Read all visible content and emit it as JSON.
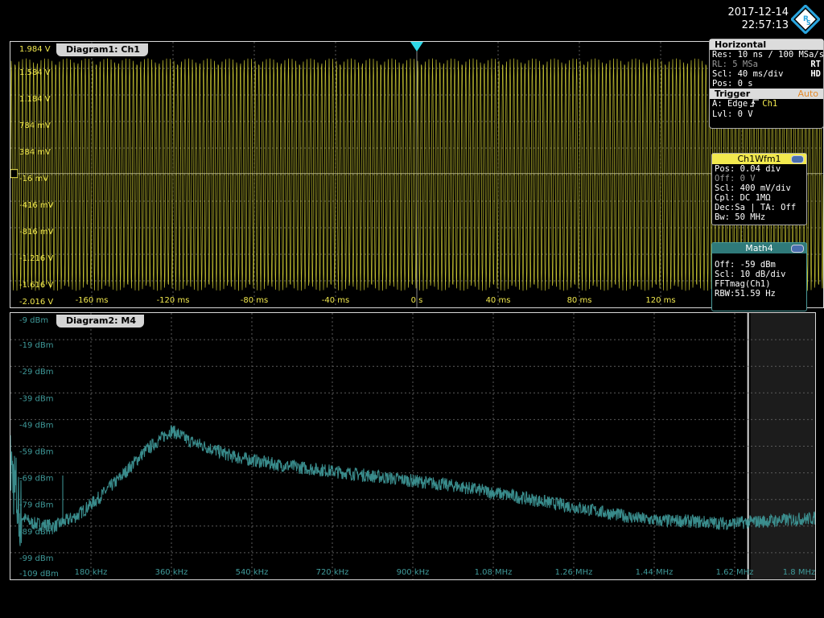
{
  "header": {
    "date": "2017-12-14",
    "time": "22:57:13",
    "logo_letters": "RS"
  },
  "diagram1": {
    "title": "Diagram1: Ch1",
    "y_labels": [
      "1.984 V",
      "1.584 V",
      "1.184 V",
      "784 mV",
      "384 mV",
      "-16 mV",
      "-416 mV",
      "-816 mV",
      "-1.216 V",
      "-1.616 V",
      "-2.016 V"
    ],
    "x_labels": [
      "-160 ms",
      "-120 ms",
      "-80 ms",
      "-40 ms",
      "0 s",
      "40 ms",
      "80 ms",
      "120 ms"
    ],
    "trace_color": "#e8e43a"
  },
  "diagram2": {
    "title": "Diagram2: M4",
    "y_labels": [
      "-9 dBm",
      "-19 dBm",
      "-29 dBm",
      "-39 dBm",
      "-49 dBm",
      "-59 dBm",
      "-69 dBm",
      "-79 dBm",
      "-89 dBm",
      "-99 dBm",
      "-109 dBm"
    ],
    "x_labels": [
      "180 kHz",
      "360 kHz",
      "540 kHz",
      "720 kHz",
      "900 kHz",
      "1.08 MHz",
      "1.26 MHz",
      "1.44 MHz",
      "1.62 MHz",
      "1.8 MHz"
    ],
    "trace_color": "#3f9a9a"
  },
  "horizontal_panel": {
    "title": "Horizontal",
    "res": "Res: 10 ns / 100 MSa/s",
    "rl": "RL:  5 MSa",
    "rt": "RT",
    "scl": "Scl:  40 ms/div",
    "hd": "HD",
    "pos": "Pos: 0 s",
    "trigger_title": "Trigger",
    "trigger_mode": "Auto",
    "trigger_a_prefix": "A:   Edge",
    "trigger_source": "Ch1",
    "trigger_lvl": "Lvl:  0 V"
  },
  "ch1_box": {
    "title": "Ch1Wfm1",
    "pos": "Pos: 0.04 div",
    "off": "Off:  0 V",
    "scl": "Scl:  400 mV/div",
    "cpl": "Cpl:  DC 1MΩ",
    "dec": "Dec:Sa | TA: Off",
    "bw": "Bw:  50 MHz"
  },
  "math4_box": {
    "title": "Math4",
    "off": "Off:   -59 dBm",
    "scl": "Scl:  10 dB/div",
    "fft": "FFTmag(Ch1)",
    "rbw": "RBW:51.59 Hz"
  },
  "chart_data": [
    {
      "type": "line",
      "title": "Diagram1: Ch1",
      "xlabel": "",
      "ylabel": "",
      "x_unit": "ms",
      "xlim": [
        -200,
        200
      ],
      "ylim": [
        -2.016,
        1.984
      ],
      "series": [
        {
          "description": "dense sinusoid",
          "amplitude_V": 1.75,
          "offset_V": -0.016
        }
      ]
    },
    {
      "type": "line",
      "title": "Diagram2: M4",
      "xlabel": "",
      "ylabel": "",
      "x_unit": "kHz",
      "xlim": [
        0,
        1800
      ],
      "ylim": [
        -109,
        -9
      ],
      "series": [
        {
          "x": [
            0,
            20,
            50,
            100,
            150,
            200,
            250,
            300,
            330,
            360,
            400,
            500,
            600,
            700,
            800,
            900,
            1000,
            1100,
            1200,
            1300,
            1400,
            1450,
            1500,
            1600,
            1700,
            1800
          ],
          "values": [
            -65,
            -85,
            -88,
            -89,
            -85,
            -78,
            -70,
            -61,
            -57,
            -53,
            -57,
            -63,
            -66,
            -68,
            -70,
            -72,
            -74,
            -77,
            -80,
            -83,
            -86,
            -87,
            -87,
            -88,
            -87,
            -86
          ]
        }
      ]
    }
  ]
}
